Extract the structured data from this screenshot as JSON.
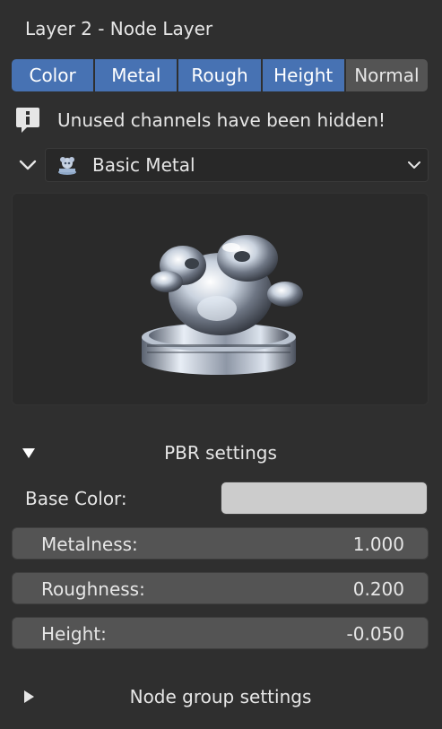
{
  "panel": {
    "title": "Layer 2 - Node Layer"
  },
  "tabs": [
    {
      "label": "Color",
      "active": true
    },
    {
      "label": "Metal",
      "active": true
    },
    {
      "label": "Rough",
      "active": true
    },
    {
      "label": "Height",
      "active": true
    },
    {
      "label": "Normal",
      "active": false
    }
  ],
  "info": {
    "message": "Unused channels have been hidden!",
    "icon": "info-icon"
  },
  "material": {
    "name": "Basic Metal",
    "icon": "material-icon",
    "expanded": true
  },
  "pbr": {
    "header": "PBR settings",
    "expanded": true,
    "base_color_label": "Base Color:",
    "base_color_value": "#cccccc",
    "metalness_label": "Metalness:",
    "metalness_value": "1.000",
    "roughness_label": "Roughness:",
    "roughness_value": "0.200",
    "height_label": "Height:",
    "height_value": "-0.050"
  },
  "node_group": {
    "header": "Node group settings",
    "expanded": false
  },
  "colors": {
    "accent": "#4772b3",
    "panel_bg": "#2f2f2f",
    "field_bg": "#545454"
  }
}
